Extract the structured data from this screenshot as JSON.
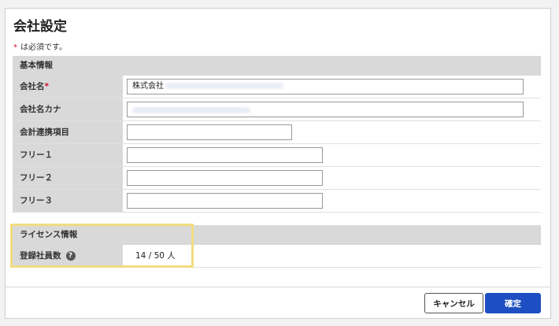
{
  "page": {
    "title": "会社設定",
    "required_note": "は必須です。",
    "required_mark": "*"
  },
  "basic_section": {
    "title": "基本情報"
  },
  "fields": {
    "company_name": {
      "label": "会社名",
      "required_mark": "*",
      "value_prefix": "株式会社"
    },
    "company_kana": {
      "label": "会社名カナ"
    },
    "accounting_link": {
      "label": "会計連携項目"
    },
    "free1": {
      "label": "フリー１"
    },
    "free2": {
      "label": "フリー２"
    },
    "free3": {
      "label": "フリー３"
    }
  },
  "license_section": {
    "title": "ライセンス情報"
  },
  "license": {
    "label": "登録社員数",
    "help_icon": "?",
    "value": "14 / 50 人"
  },
  "footer": {
    "cancel_label": "キャンセル",
    "confirm_label": "確定"
  },
  "colors": {
    "required": "#c8102e",
    "primary": "#1e4fc2",
    "highlight": "#f2dc80",
    "label_bg": "#d9d9d9"
  }
}
